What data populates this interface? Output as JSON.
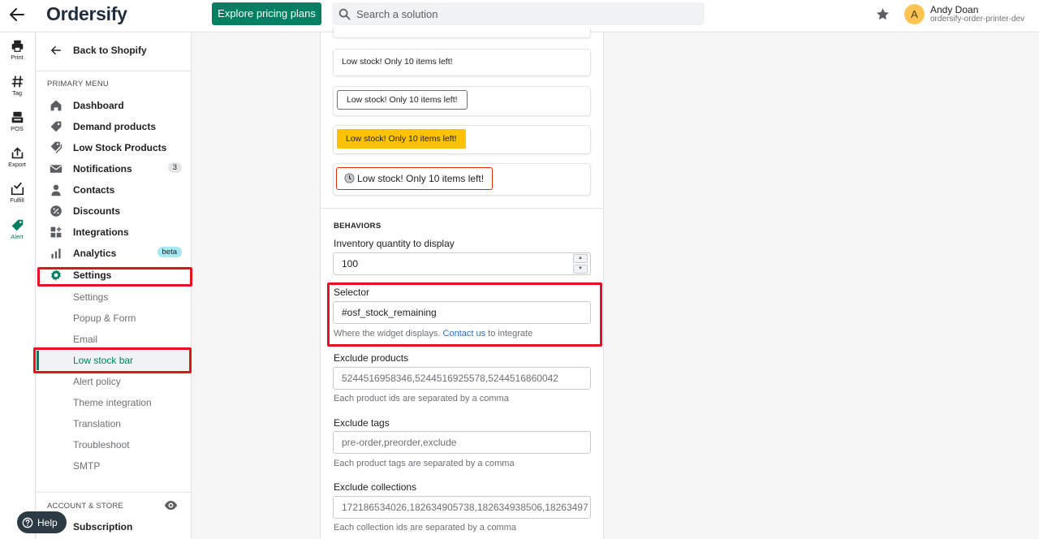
{
  "topbar": {
    "logo": "Ordersify",
    "explore_label": "Explore pricing plans",
    "search_placeholder": "Search a solution",
    "user_initial": "A",
    "user_name": "Andy Doan",
    "user_store": "ordersify-order-printer-dev"
  },
  "rail": {
    "items": [
      {
        "label": "Print",
        "icon": "printer-icon"
      },
      {
        "label": "Tag",
        "icon": "hashtag-icon"
      },
      {
        "label": "POS",
        "icon": "pos-icon"
      },
      {
        "label": "Export",
        "icon": "export-icon"
      },
      {
        "label": "Fulfill",
        "icon": "fulfill-icon"
      },
      {
        "label": "Alert",
        "icon": "alert-tag-icon",
        "active": true
      }
    ]
  },
  "sidebar": {
    "back_label": "Back to Shopify",
    "primary_heading": "PRIMARY MENU",
    "items": [
      {
        "label": "Dashboard",
        "icon": "home-icon"
      },
      {
        "label": "Demand products",
        "icon": "tag-icon"
      },
      {
        "label": "Low Stock Products",
        "icon": "tags-icon"
      },
      {
        "label": "Notifications",
        "icon": "mail-icon",
        "count": "3"
      },
      {
        "label": "Contacts",
        "icon": "person-icon"
      },
      {
        "label": "Discounts",
        "icon": "discount-icon"
      },
      {
        "label": "Integrations",
        "icon": "apps-icon"
      },
      {
        "label": "Analytics",
        "icon": "analytics-icon",
        "badge": "beta"
      },
      {
        "label": "Settings",
        "icon": "gear-icon"
      }
    ],
    "sub_items": [
      {
        "label": "Settings"
      },
      {
        "label": "Popup & Form"
      },
      {
        "label": "Email"
      },
      {
        "label": "Low stock bar",
        "active": true
      },
      {
        "label": "Alert policy"
      },
      {
        "label": "Theme integration"
      },
      {
        "label": "Translation"
      },
      {
        "label": "Troubleshoot"
      },
      {
        "label": "SMTP"
      }
    ],
    "account_heading": "ACCOUNT & STORE",
    "subscription_label": "Subscription",
    "help_label": "Help"
  },
  "main": {
    "badges": [
      "Low stock! Only 10 items left!",
      "Low stock! Only 10 items left!",
      "Low stock! Only 10 items left!",
      "Low stock! Only 10 items left!"
    ],
    "behaviors_heading": "BEHAVIORS",
    "inventory": {
      "label": "Inventory quantity to display",
      "value": "100"
    },
    "selector": {
      "label": "Selector",
      "value": "#osf_stock_remaining",
      "help_prefix": "Where the widget displays.",
      "help_link": "Contact us",
      "help_suffix": "to integrate"
    },
    "exclude_products": {
      "label": "Exclude products",
      "placeholder": "5244516958346,5244516925578,5244516860042",
      "help": "Each product ids are separated by a comma"
    },
    "exclude_tags": {
      "label": "Exclude tags",
      "placeholder": "pre-order,preorder,exclude",
      "help": "Each product tags are separated by a comma"
    },
    "exclude_collections": {
      "label": "Exclude collections",
      "placeholder": "172186534026,182634905738,182634938506,18263497",
      "help": "Each collection ids are separated by a comma"
    }
  },
  "colors": {
    "brand_green": "#008060",
    "highlight_red": "#e4141f",
    "badge_yellow": "#ffc200",
    "link_blue": "#2c6ecb",
    "beta_blue": "#a4e8f2"
  }
}
